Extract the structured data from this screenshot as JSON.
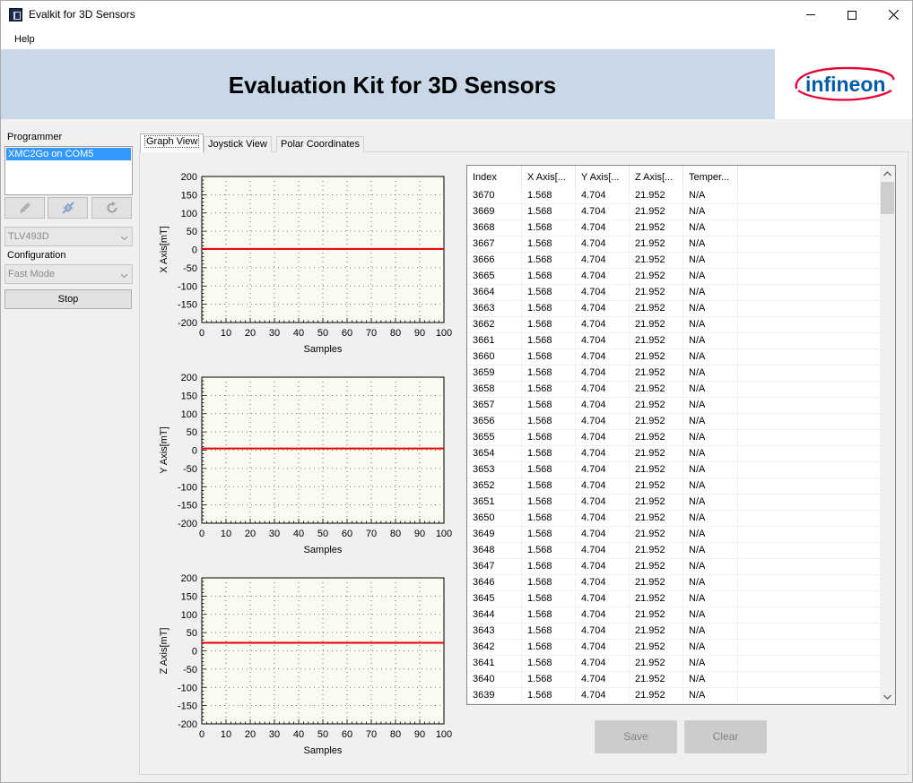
{
  "window": {
    "title": "Evalkit for 3D Sensors"
  },
  "menu": {
    "help": "Help"
  },
  "banner": {
    "title": "Evaluation Kit for 3D Sensors",
    "logo_text": "infineon"
  },
  "left": {
    "programmer_label": "Programmer",
    "programmer_items": [
      "XMC2Go on COM5"
    ],
    "sensor_value": "TLV493D",
    "configuration_label": "Configuration",
    "configuration_value": "Fast Mode",
    "stop_label": "Stop"
  },
  "tabs": [
    "Graph View",
    "Joystick View",
    "Polar Coordinates"
  ],
  "charts": [
    {
      "ylabel": "X Axis[mT]",
      "xlabel": "Samples",
      "value": 1.568
    },
    {
      "ylabel": "Y Axis[mT]",
      "xlabel": "Samples",
      "value": 4.704
    },
    {
      "ylabel": "Z Axis[mT]",
      "xlabel": "Samples",
      "value": 21.952
    }
  ],
  "chart_data": [
    {
      "type": "line",
      "xlabel": "Samples",
      "ylabel": "X Axis[mT]",
      "xlim": [
        0,
        100
      ],
      "ylim": [
        -200,
        200
      ],
      "xticks": [
        "0",
        "10",
        "20",
        "30",
        "40",
        "50",
        "60",
        "70",
        "80",
        "90",
        "100"
      ],
      "yticks": [
        "200",
        "150",
        "100",
        "50",
        "0",
        "-50",
        "-100",
        "-150",
        "-200"
      ],
      "series": [
        {
          "x": [
            0,
            100
          ],
          "y": [
            1.568,
            1.568
          ]
        }
      ],
      "grid": true
    },
    {
      "type": "line",
      "xlabel": "Samples",
      "ylabel": "Y Axis[mT]",
      "xlim": [
        0,
        100
      ],
      "ylim": [
        -200,
        200
      ],
      "xticks": [
        "0",
        "10",
        "20",
        "30",
        "40",
        "50",
        "60",
        "70",
        "80",
        "90",
        "100"
      ],
      "yticks": [
        "200",
        "150",
        "100",
        "50",
        "0",
        "-50",
        "-100",
        "-150",
        "-200"
      ],
      "series": [
        {
          "x": [
            0,
            100
          ],
          "y": [
            4.704,
            4.704
          ]
        }
      ],
      "grid": true
    },
    {
      "type": "line",
      "xlabel": "Samples",
      "ylabel": "Z Axis[mT]",
      "xlim": [
        0,
        100
      ],
      "ylim": [
        -200,
        200
      ],
      "xticks": [
        "0",
        "10",
        "20",
        "30",
        "40",
        "50",
        "60",
        "70",
        "80",
        "90",
        "100"
      ],
      "yticks": [
        "200",
        "150",
        "100",
        "50",
        "0",
        "-50",
        "-100",
        "-150",
        "-200"
      ],
      "series": [
        {
          "x": [
            0,
            100
          ],
          "y": [
            21.952,
            21.952
          ]
        }
      ],
      "grid": true
    }
  ],
  "table": {
    "columns": [
      "Index",
      "X Axis[...",
      "Y Axis[...",
      "Z Axis[...",
      "Temper..."
    ],
    "rows": [
      [
        "3670",
        "1.568",
        "4.704",
        "21.952",
        "N/A"
      ],
      [
        "3669",
        "1.568",
        "4.704",
        "21.952",
        "N/A"
      ],
      [
        "3668",
        "1.568",
        "4.704",
        "21.952",
        "N/A"
      ],
      [
        "3667",
        "1.568",
        "4.704",
        "21.952",
        "N/A"
      ],
      [
        "3666",
        "1.568",
        "4.704",
        "21.952",
        "N/A"
      ],
      [
        "3665",
        "1.568",
        "4.704",
        "21.952",
        "N/A"
      ],
      [
        "3664",
        "1.568",
        "4.704",
        "21.952",
        "N/A"
      ],
      [
        "3663",
        "1.568",
        "4.704",
        "21.952",
        "N/A"
      ],
      [
        "3662",
        "1.568",
        "4.704",
        "21.952",
        "N/A"
      ],
      [
        "3661",
        "1.568",
        "4.704",
        "21.952",
        "N/A"
      ],
      [
        "3660",
        "1.568",
        "4.704",
        "21.952",
        "N/A"
      ],
      [
        "3659",
        "1.568",
        "4.704",
        "21.952",
        "N/A"
      ],
      [
        "3658",
        "1.568",
        "4.704",
        "21.952",
        "N/A"
      ],
      [
        "3657",
        "1.568",
        "4.704",
        "21.952",
        "N/A"
      ],
      [
        "3656",
        "1.568",
        "4.704",
        "21.952",
        "N/A"
      ],
      [
        "3655",
        "1.568",
        "4.704",
        "21.952",
        "N/A"
      ],
      [
        "3654",
        "1.568",
        "4.704",
        "21.952",
        "N/A"
      ],
      [
        "3653",
        "1.568",
        "4.704",
        "21.952",
        "N/A"
      ],
      [
        "3652",
        "1.568",
        "4.704",
        "21.952",
        "N/A"
      ],
      [
        "3651",
        "1.568",
        "4.704",
        "21.952",
        "N/A"
      ],
      [
        "3650",
        "1.568",
        "4.704",
        "21.952",
        "N/A"
      ],
      [
        "3649",
        "1.568",
        "4.704",
        "21.952",
        "N/A"
      ],
      [
        "3648",
        "1.568",
        "4.704",
        "21.952",
        "N/A"
      ],
      [
        "3647",
        "1.568",
        "4.704",
        "21.952",
        "N/A"
      ],
      [
        "3646",
        "1.568",
        "4.704",
        "21.952",
        "N/A"
      ],
      [
        "3645",
        "1.568",
        "4.704",
        "21.952",
        "N/A"
      ],
      [
        "3644",
        "1.568",
        "4.704",
        "21.952",
        "N/A"
      ],
      [
        "3643",
        "1.568",
        "4.704",
        "21.952",
        "N/A"
      ],
      [
        "3642",
        "1.568",
        "4.704",
        "21.952",
        "N/A"
      ],
      [
        "3641",
        "1.568",
        "4.704",
        "21.952",
        "N/A"
      ],
      [
        "3640",
        "1.568",
        "4.704",
        "21.952",
        "N/A"
      ],
      [
        "3639",
        "1.568",
        "4.704",
        "21.952",
        "N/A"
      ]
    ]
  },
  "actions": {
    "save": "Save",
    "clear": "Clear"
  },
  "colors": {
    "banner_bg": "#c9d8e6",
    "line_red": "#e60000",
    "plot_bg": "#fafaf0",
    "logo_red": "#e30034",
    "logo_blue": "#005ca9"
  },
  "icons": [
    "app-icon",
    "minimize-icon",
    "maximize-icon",
    "close-icon",
    "pencil-icon",
    "connect-icon",
    "refresh-icon",
    "chevron-down-icon",
    "scroll-up-icon",
    "scroll-down-icon"
  ]
}
